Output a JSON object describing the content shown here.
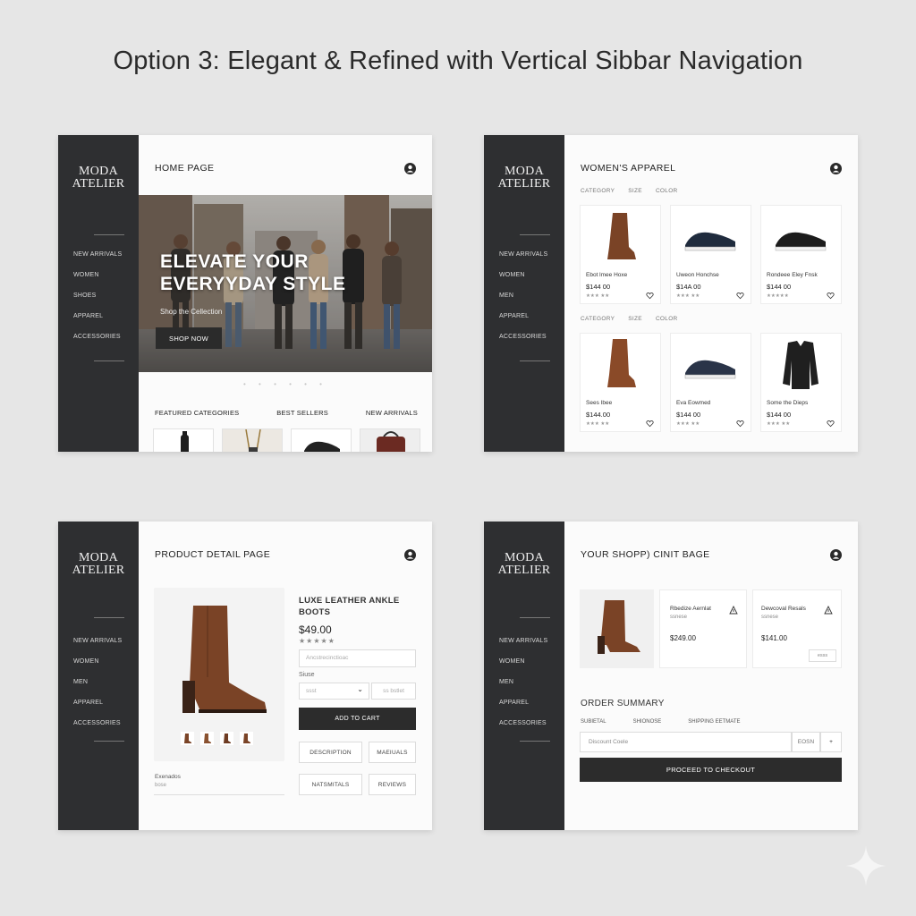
{
  "page": {
    "title": "Option 3: Elegant & Refined with Vertical Sibbar Navigation"
  },
  "brand": {
    "line1": "MODA",
    "line2": "ATELIER"
  },
  "nav": [
    "NEW ARRIVALS",
    "WOMEN",
    "SHOES",
    "APPAREL",
    "ACCESSORIES"
  ],
  "nav_pdp": [
    "NEW ARRIVALS",
    "WOMEN",
    "MEN",
    "APPAREL",
    "ACCESSORIES"
  ],
  "home": {
    "title": "HOME PAGE",
    "hero_line1": "ELEVATE YOUR",
    "hero_line2": "EVERYYDAY STYLE",
    "hero_sub": "Shop the Cellection",
    "hero_button": "SHOP NOW",
    "dots": "• • • • • •",
    "tabs": [
      "FEATURED CATEGORIES",
      "BEST SELLERS",
      "NEW ARRIVALS"
    ]
  },
  "womens": {
    "title": "WOMEN'S APPAREL",
    "filters": [
      "CATEGORY",
      "SIZE",
      "COLOR"
    ],
    "row1": [
      {
        "name": "Ebot lmee Hoxe",
        "price": "$144 00",
        "rating": "★★★ ★★"
      },
      {
        "name": "Uweon Honchse",
        "price": "$14A 00",
        "rating": "★★★ ★★"
      },
      {
        "name": "Rondeee Eley Fnsk",
        "price": "$144 00",
        "rating": "★★★★★"
      }
    ],
    "row2": [
      {
        "name": "Sees Ibee",
        "price": "$144.00",
        "rating": "★★★ ★★"
      },
      {
        "name": "Eva Eowmed",
        "price": "$144 00",
        "rating": "★★★ ★★"
      },
      {
        "name": "Some the Dieps",
        "price": "$144 00",
        "rating": "★★★ ★★"
      }
    ]
  },
  "pdp": {
    "title": "PRODUCT DETAIL PAGE",
    "name": "LUXE LEATHER ANKLE BOOTS",
    "price": "$49.00",
    "stars": "★★★★★",
    "select_placeholder": "Ancstrecinctioac",
    "size_label": "Siuse",
    "qty": "ssst",
    "qty_arrow": "⌄",
    "qty_right": "ss bstlet",
    "add_to_cart": "ADD TO CART",
    "btn_description": "DESCRIPTION",
    "btn_materials": "MAEIUALS",
    "btn_materials2": "NATSMITALS",
    "btn_reviews": "REVIEWS",
    "meta_label": "Exenados",
    "meta_value": "bose"
  },
  "cart": {
    "title": "YOUR SHOPP) CINIT BAGE",
    "items": [
      {
        "name": "Rbedize Aernlat",
        "sub": "ssnese",
        "price": "$249.00"
      },
      {
        "name": "Dewcoval Resals",
        "sub": "ssnese",
        "price": "$141.00"
      }
    ],
    "item_action": "esss",
    "summary_title": "ORDER SUMMARY",
    "summary_cols": [
      "SUBIETAL",
      "SHIONOSE",
      "SHIPPING EETMATE"
    ],
    "discount_placeholder": "Discount Coele",
    "discount_btn": "EOSN",
    "discount_plus": "+",
    "checkout": "PROCEED TO CHECKOUT"
  },
  "colors": {
    "sidebar": "#2e2f31",
    "accent_dark": "#2c2c2c",
    "boot": "#7a4326",
    "background": "#e6e6e6"
  }
}
